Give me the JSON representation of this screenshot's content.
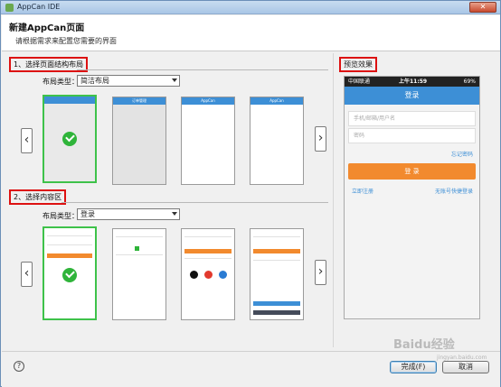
{
  "window": {
    "title": "AppCan IDE",
    "close_label": "✕"
  },
  "header": {
    "title": "新建AppCan页面",
    "subtitle": "请根据需求来配置您需要的界面"
  },
  "section1": {
    "label": "1、选择页面结构布局",
    "type_label": "布局类型：",
    "select_value": "简洁布局",
    "thumbs": [
      {
        "bar": ""
      },
      {
        "bar": "订单管理"
      },
      {
        "bar": "AppCan"
      },
      {
        "bar": "AppCan"
      }
    ]
  },
  "section2": {
    "label": "2、选择内容区",
    "type_label": "布局类型：",
    "select_value": "登录"
  },
  "preview": {
    "label": "预览效果",
    "status_left": "中国联通",
    "status_time": "上午11:59",
    "status_right": "69%",
    "nav_title": "登录",
    "input1_placeholder": "手机/邮箱/用户名",
    "input2_placeholder": "密码",
    "forgot_link": "忘记密码",
    "login_button": "登 录",
    "register_link": "立即注册",
    "quick_login_link": "无账号快捷登录"
  },
  "footer": {
    "help": "?",
    "finish": "完成(F)",
    "cancel": "取消"
  },
  "watermark": {
    "brand": "Baidu经验",
    "url": "jingyan.baidu.com"
  }
}
